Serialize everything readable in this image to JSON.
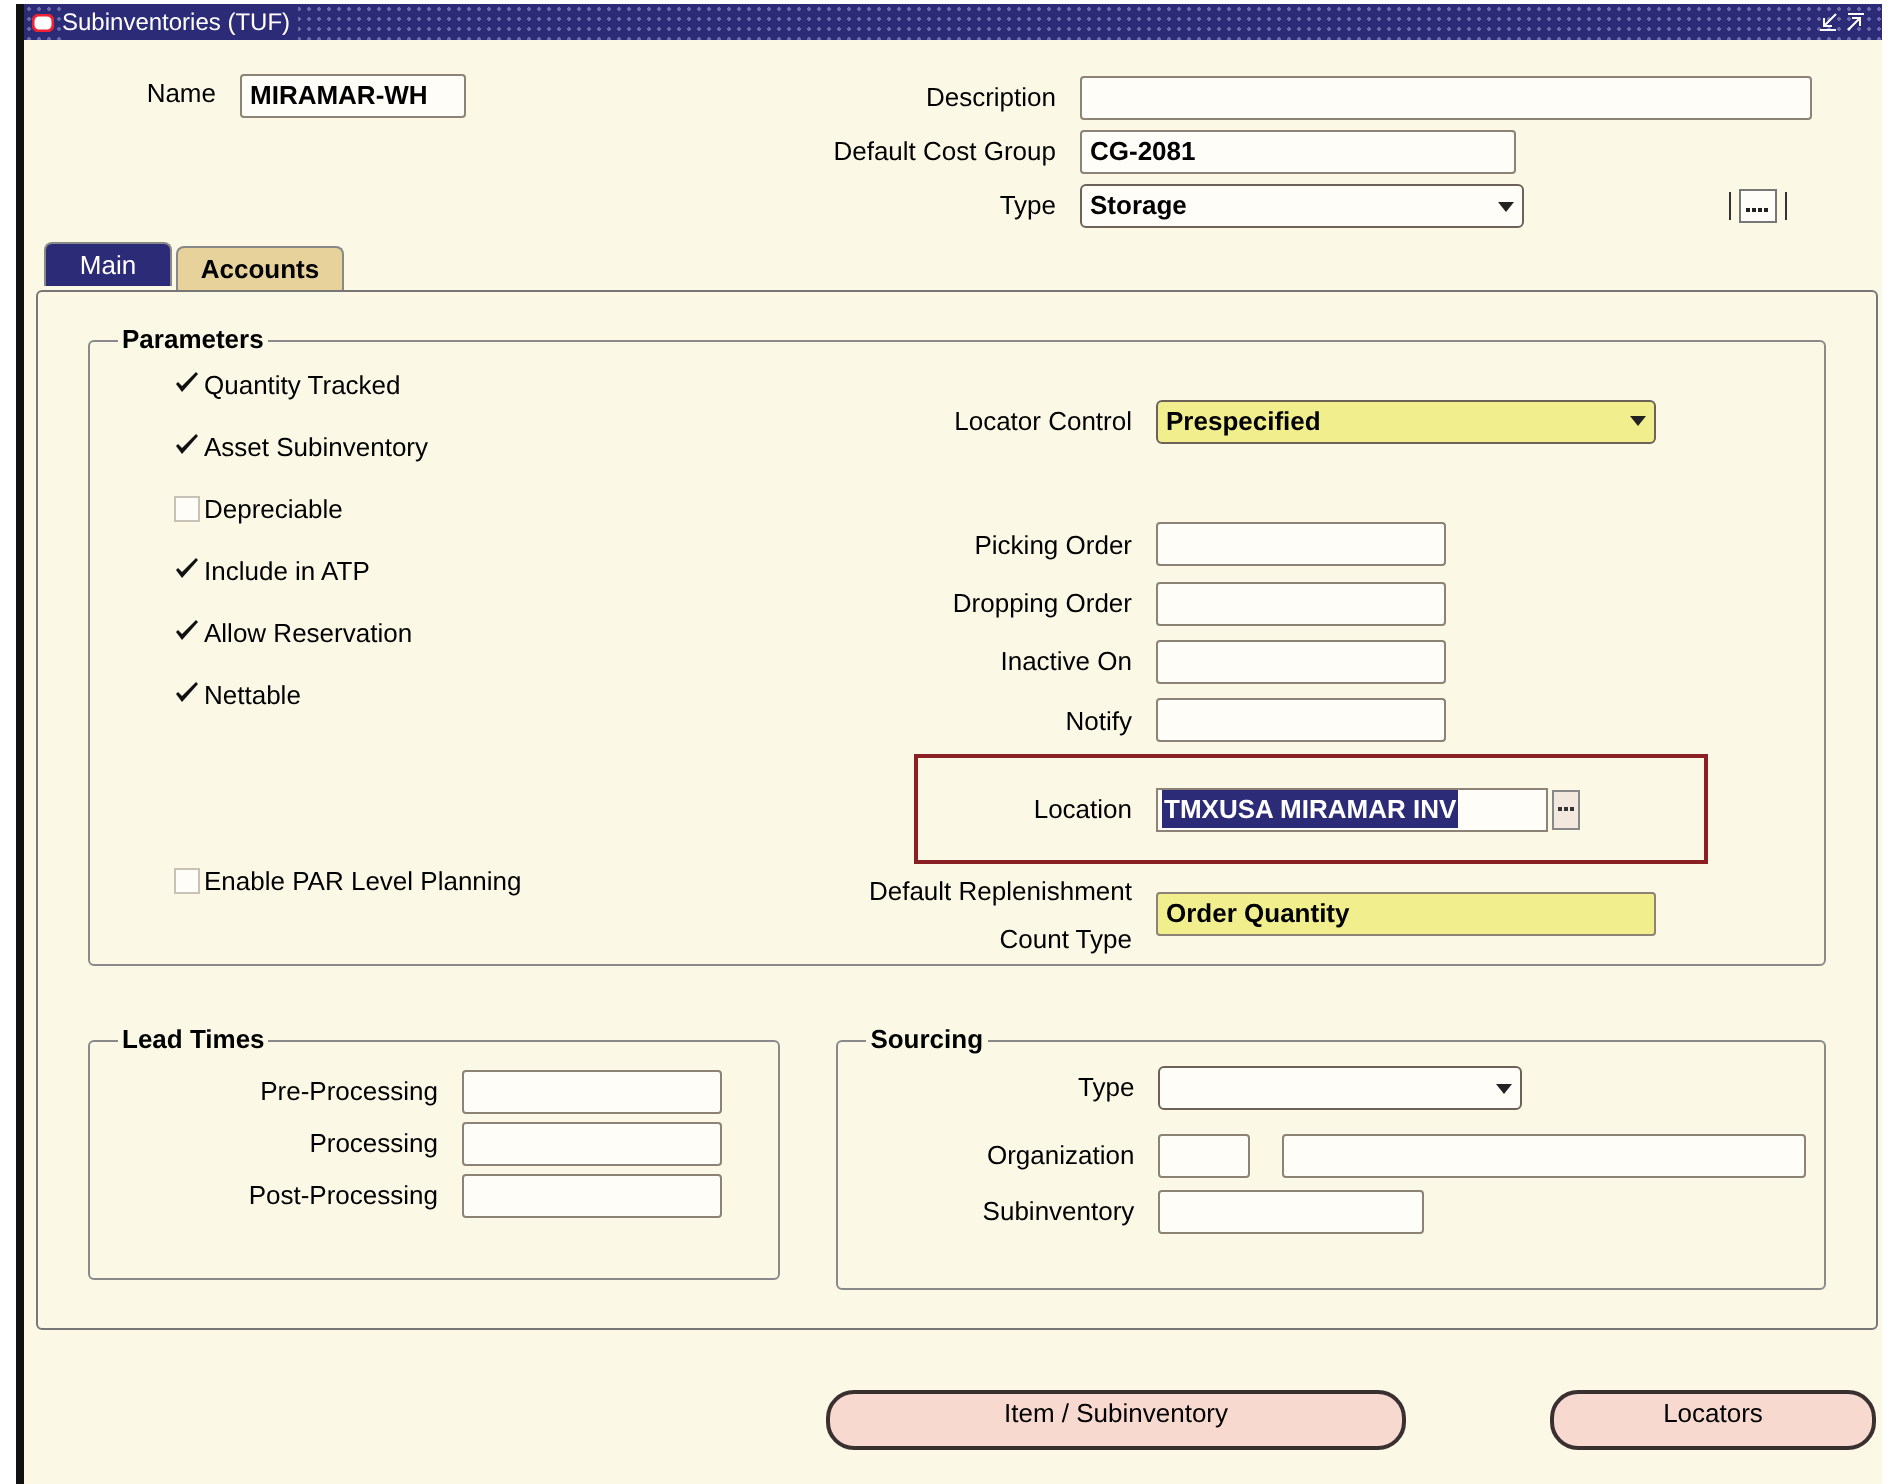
{
  "window": {
    "title": "Subinventories (TUF)"
  },
  "header": {
    "name": {
      "label": "Name",
      "value": "MIRAMAR-WH"
    },
    "description": {
      "label": "Description"
    },
    "default_cost_group": {
      "label": "Default Cost Group",
      "value": "CG-2081"
    },
    "type": {
      "label": "Type",
      "value": "Storage"
    }
  },
  "tabs": [
    {
      "label": "Main",
      "selected": true
    },
    {
      "label": "Accounts",
      "selected": false
    }
  ],
  "parameters": {
    "title": "Parameters",
    "checkboxes": [
      {
        "label": "Quantity Tracked",
        "checked": true
      },
      {
        "label": "Asset Subinventory",
        "checked": true
      },
      {
        "label": "Depreciable",
        "checked": false
      },
      {
        "label": "Include in ATP",
        "checked": true
      },
      {
        "label": "Allow Reservation",
        "checked": true
      },
      {
        "label": "Nettable",
        "checked": true
      }
    ],
    "par_checkbox": {
      "label": "Enable PAR Level Planning",
      "checked": false
    },
    "locator_control": {
      "label": "Locator Control",
      "value": "Prespecified",
      "required": true
    },
    "fields": [
      {
        "label": "Picking Order"
      },
      {
        "label": "Dropping Order"
      },
      {
        "label": "Inactive On"
      },
      {
        "label": "Notify"
      }
    ],
    "location": {
      "label": "Location",
      "value": "TMXUSA MIRAMAR INV",
      "highlighted": true
    },
    "replenishment": {
      "label_lines": [
        "Default Replenishment",
        "Count Type"
      ],
      "value": "Order Quantity",
      "required": true
    }
  },
  "lead_times": {
    "title": "Lead Times",
    "fields": [
      {
        "label": "Pre-Processing"
      },
      {
        "label": "Processing"
      },
      {
        "label": "Post-Processing"
      }
    ]
  },
  "sourcing": {
    "title": "Sourcing",
    "type": {
      "label": "Type"
    },
    "organization": {
      "label": "Organization"
    },
    "subinventory": {
      "label": "Subinventory"
    }
  },
  "buttons": [
    {
      "label": "Item / Subinventory"
    },
    {
      "label": "Locators"
    }
  ]
}
